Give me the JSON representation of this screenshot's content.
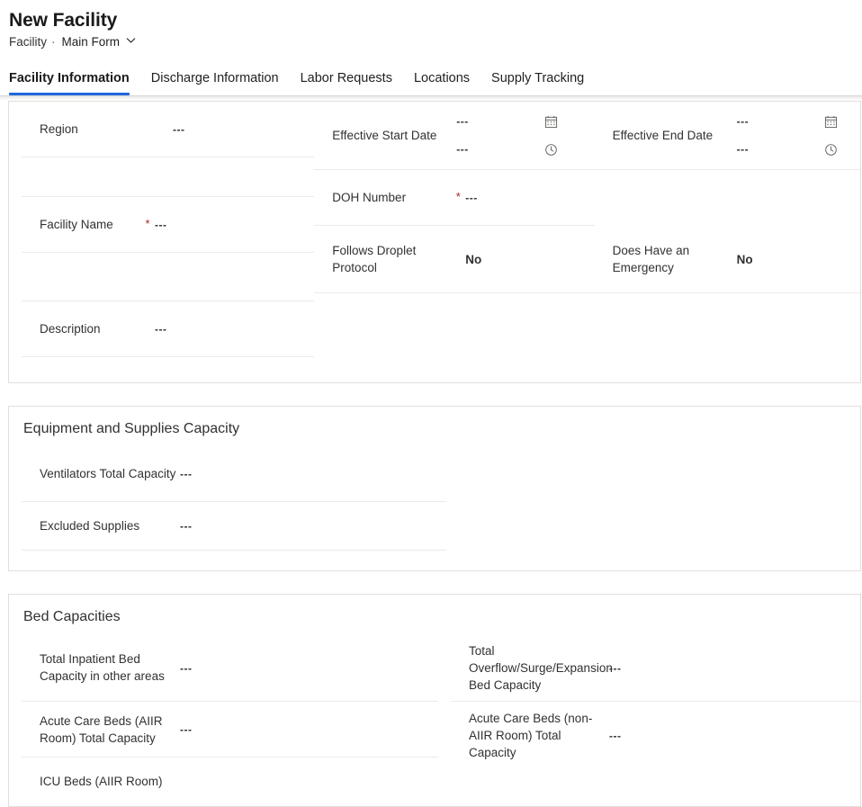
{
  "header": {
    "title": "New Facility",
    "entity": "Facility",
    "separator": "·",
    "form_name": "Main Form",
    "chevron_icon": "chevron-down-icon"
  },
  "tabs": [
    {
      "label": "Facility Information",
      "active": true
    },
    {
      "label": "Discharge Information",
      "active": false
    },
    {
      "label": "Labor Requests",
      "active": false
    },
    {
      "label": "Locations",
      "active": false
    },
    {
      "label": "Supply Tracking",
      "active": false
    }
  ],
  "placeholder_value": "---",
  "required_marker": "*",
  "icons": {
    "calendar": "calendar-icon",
    "clock": "clock-icon"
  },
  "sections": {
    "facility_details": {
      "column_left": [
        {
          "label": "Region",
          "value": "---",
          "required": false
        },
        {
          "label": "Facility Name",
          "value": "---",
          "required": true
        },
        {
          "label": "Description",
          "value": "---",
          "required": false
        }
      ],
      "column_middle": [
        {
          "label": "Effective Start Date",
          "date_value": "---",
          "time_value": "---",
          "type": "datetime"
        },
        {
          "label": "DOH Number",
          "value": "---",
          "required": true
        },
        {
          "label": "Follows Droplet Protocol",
          "value": "No",
          "required": false
        }
      ],
      "column_right": [
        {
          "label": "Effective End Date",
          "date_value": "---",
          "time_value": "---",
          "type": "datetime"
        },
        {
          "label": "Does Have an Emergency",
          "value": "No",
          "required": false
        }
      ]
    },
    "equipment": {
      "title": "Equipment and Supplies Capacity",
      "fields": [
        {
          "label": "Ventilators Total Capacity",
          "value": "---"
        },
        {
          "label": "Excluded Supplies",
          "value": "---"
        }
      ]
    },
    "bed_capacities": {
      "title": "Bed Capacities",
      "column_left": [
        {
          "label": "Total Inpatient Bed Capacity in other areas",
          "value": "---"
        },
        {
          "label": "Acute Care Beds (AIIR Room) Total Capacity",
          "value": "---"
        },
        {
          "label": "ICU Beds (AIIR Room)",
          "value": ""
        }
      ],
      "column_right": [
        {
          "label": "Total Overflow/Surge/Expansion Bed Capacity",
          "value": "---"
        },
        {
          "label": "Acute Care Beds (non-AIIR Room) Total Capacity",
          "value": "---"
        }
      ]
    }
  },
  "colors": {
    "accent": "#2266dd",
    "required": "#a4262c",
    "text": "#323130",
    "border": "#e1dfdd",
    "row_divider": "#edebe9"
  }
}
